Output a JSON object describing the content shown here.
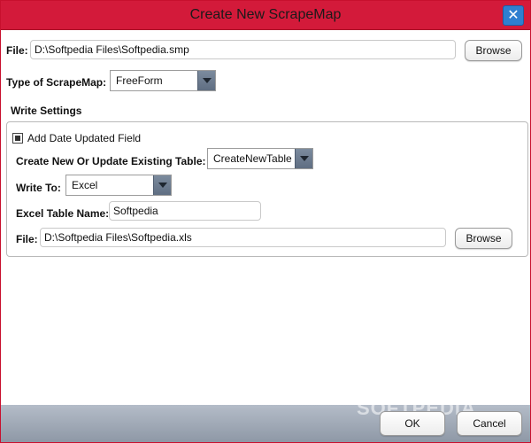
{
  "window": {
    "title": "Create New ScrapeMap",
    "close_glyph": "✕"
  },
  "file_row": {
    "label": "File:",
    "value": "D:\\Softpedia Files\\Softpedia.smp",
    "browse_label": "Browse"
  },
  "type_row": {
    "label": "Type of ScrapeMap:",
    "value": "FreeForm"
  },
  "write_settings": {
    "title": "Write Settings",
    "add_date_label": "Add Date Updated Field",
    "create_update_label": "Create New Or Update Existing Table:",
    "create_update_value": "CreateNewTable",
    "write_to_label": "Write To:",
    "write_to_value": "Excel",
    "table_name_label": "Excel Table Name:",
    "table_name_value": "Softpedia",
    "file_label": "File:",
    "file_value": "D:\\Softpedia Files\\Softpedia.xls",
    "browse_label": "Browse"
  },
  "footer": {
    "ok_label": "OK",
    "cancel_label": "Cancel",
    "watermark": "SOFTPEDIA"
  },
  "colors": {
    "titlebar": "#d31a3a",
    "close_button": "#2f7fd0",
    "footer": "#a3acb8"
  }
}
